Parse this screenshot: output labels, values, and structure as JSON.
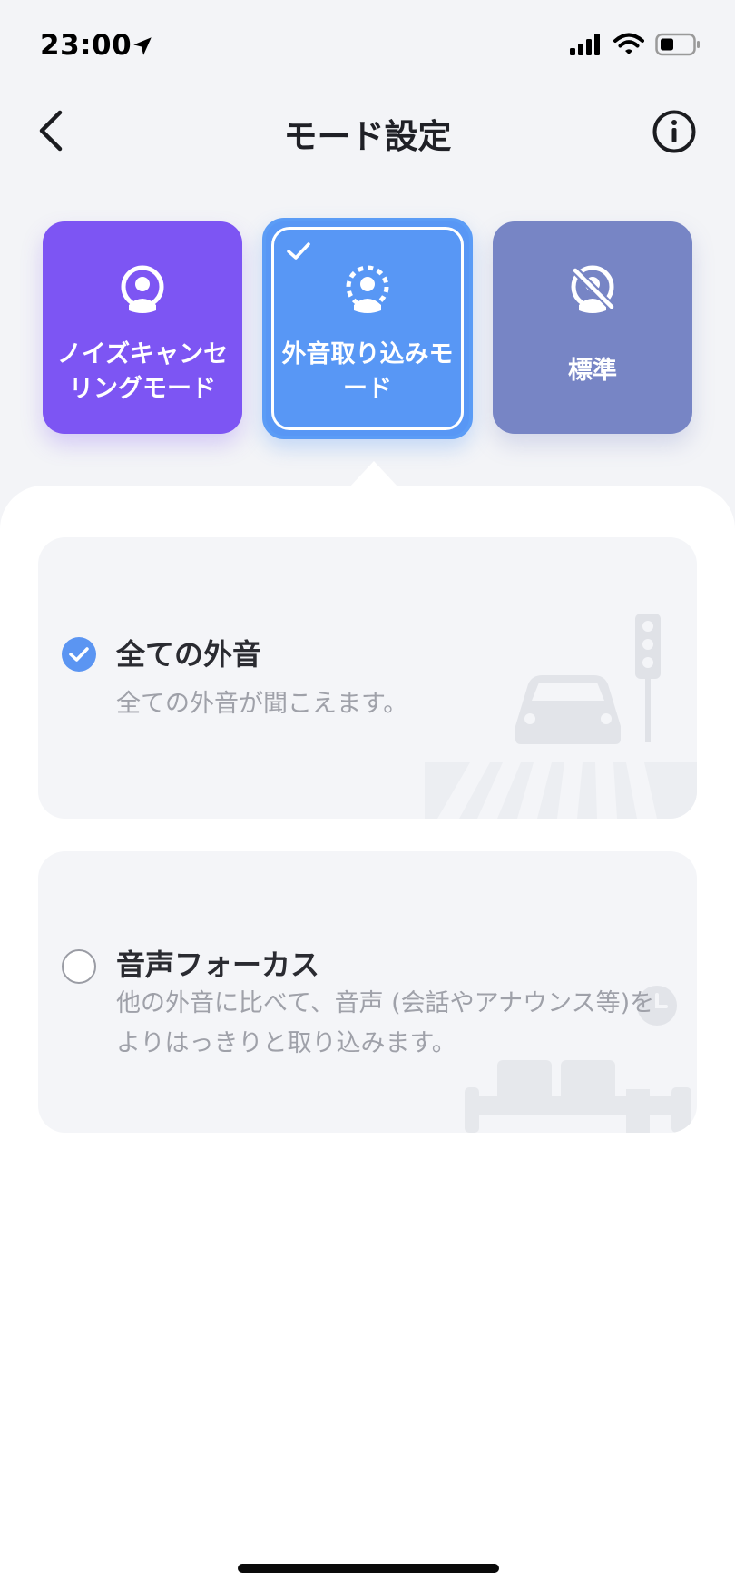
{
  "status_bar": {
    "time": "23:00",
    "icons": [
      "location-arrow-icon",
      "cellular-signal-icon",
      "wifi-icon",
      "battery-icon"
    ]
  },
  "nav": {
    "title": "モード設定",
    "back_icon": "chevron-left-icon",
    "info_icon": "info-icon"
  },
  "modes": [
    {
      "label": "ノイズキャンセリングモード",
      "icon": "noise-cancel-person-icon",
      "color": "#7d55f3",
      "selected": false
    },
    {
      "label": "外音取り込みモード",
      "icon": "ambient-person-icon",
      "color": "#5897f5",
      "selected": true
    },
    {
      "label": "標準",
      "icon": "standard-off-icon",
      "color": "#7785c5",
      "selected": false
    }
  ],
  "options": [
    {
      "title": "全ての外音",
      "desc": "全ての外音が聞こえます。",
      "selected": true,
      "illustration": "traffic-crosswalk-illustration"
    },
    {
      "title": "音声フォーカス",
      "desc": "他の外音に比べて、音声 (会話やアナウンス等)をよりはっきりと取り込みます。",
      "selected": false,
      "illustration": "waiting-room-clock-illustration"
    }
  ],
  "colors": {
    "accent": "#5b95f2",
    "background": "#f3f4f7",
    "sheet": "#ffffff"
  }
}
